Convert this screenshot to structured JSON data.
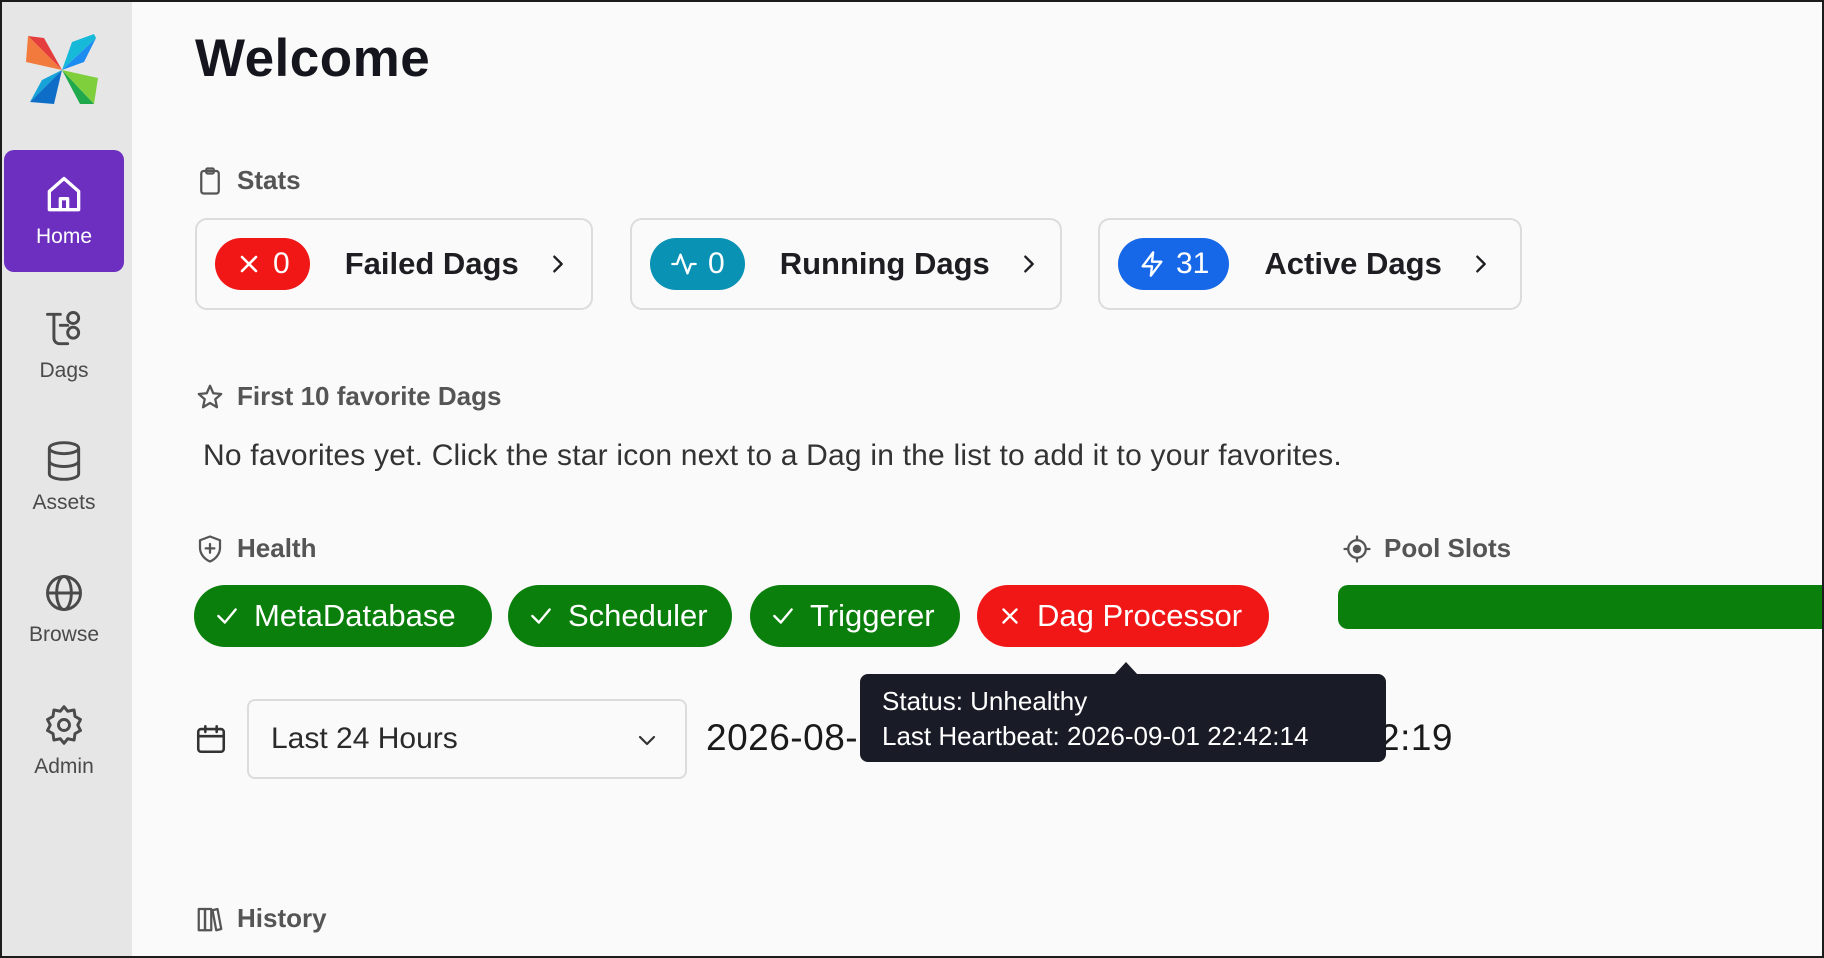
{
  "sidebar": {
    "items": [
      {
        "label": "Home",
        "icon": "home-icon"
      },
      {
        "label": "Dags",
        "icon": "dags-icon"
      },
      {
        "label": "Assets",
        "icon": "database-icon"
      },
      {
        "label": "Browse",
        "icon": "globe-icon"
      },
      {
        "label": "Admin",
        "icon": "gear-icon"
      }
    ],
    "active": "Home",
    "active_color": "#6d2fbf"
  },
  "page": {
    "title": "Welcome"
  },
  "stats": {
    "heading": "Stats",
    "cards": [
      {
        "count": "0",
        "label": "Failed Dags",
        "color": "#f21717",
        "icon": "x-icon"
      },
      {
        "count": "0",
        "label": "Running Dags",
        "color": "#0a92b5",
        "icon": "activity-icon"
      },
      {
        "count": "31",
        "label": "Active Dags",
        "color": "#1668e8",
        "icon": "bolt-icon"
      }
    ]
  },
  "favorites": {
    "heading": "First 10 favorite Dags",
    "empty_text": "No favorites yet. Click the star icon next to a Dag in the list to add it to your favorites."
  },
  "health": {
    "heading": "Health",
    "items": [
      {
        "label": "MetaDatabase",
        "status": "healthy"
      },
      {
        "label": "Scheduler",
        "status": "healthy"
      },
      {
        "label": "Triggerer",
        "status": "healthy"
      },
      {
        "label": "Dag Processor",
        "status": "unhealthy"
      }
    ],
    "healthy_color": "#0b7f0b",
    "unhealthy_color": "#f21717"
  },
  "pool_slots": {
    "heading": "Pool Slots",
    "bar_color": "#0b7f0b"
  },
  "time_range": {
    "selected": "Last 24 Hours",
    "start_visible": "2026-08-",
    "end_visible": "2:19"
  },
  "tooltip": {
    "line1": "Status: Unhealthy",
    "line2": "Last Heartbeat: 2026-09-01 22:42:14"
  },
  "history": {
    "heading": "History"
  }
}
